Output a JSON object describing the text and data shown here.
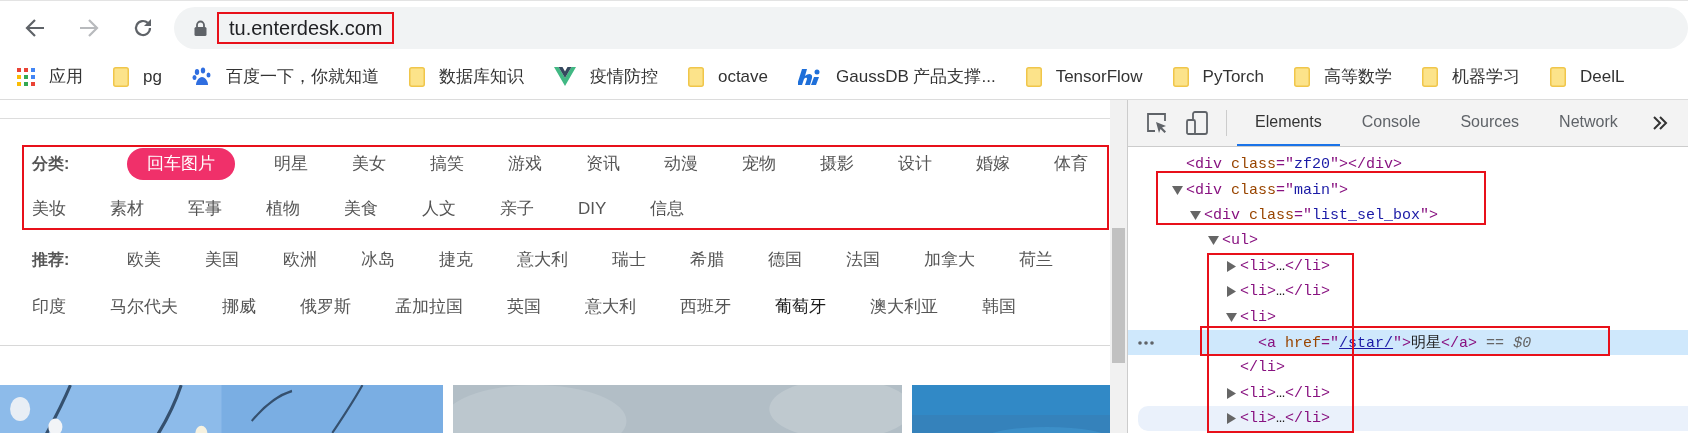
{
  "nav_buttons": [
    {
      "kind": "back",
      "disabled": false
    },
    {
      "kind": "forward",
      "disabled": true
    },
    {
      "kind": "reload",
      "disabled": false
    }
  ],
  "address_bar": {
    "url": "tu.enterdesk.com"
  },
  "bookmarks": [
    {
      "kind": "apps",
      "label": "应用"
    },
    {
      "kind": "folder",
      "label": "pg"
    },
    {
      "kind": "baidu",
      "label": "百度一下，你就知道"
    },
    {
      "kind": "folder",
      "label": "数据库知识"
    },
    {
      "kind": "vue",
      "label": "疫情防控"
    },
    {
      "kind": "folder",
      "label": "octave"
    },
    {
      "kind": "hi",
      "label": "GaussDB 产品支撑..."
    },
    {
      "kind": "folder",
      "label": "TensorFlow"
    },
    {
      "kind": "folder",
      "label": "PyTorch"
    },
    {
      "kind": "folder",
      "label": "高等数学"
    },
    {
      "kind": "folder",
      "label": "机器学习"
    },
    {
      "kind": "folder",
      "label": "DeelL"
    }
  ],
  "categories": {
    "label": "分类:",
    "items": [
      {
        "text": "回车图片",
        "selected": true
      },
      {
        "text": "明星",
        "selected": false
      },
      {
        "text": "美女",
        "selected": false
      },
      {
        "text": "搞笑",
        "selected": false
      },
      {
        "text": "游戏",
        "selected": false
      },
      {
        "text": "资讯",
        "selected": false
      },
      {
        "text": "动漫",
        "selected": false
      },
      {
        "text": "宠物",
        "selected": false
      },
      {
        "text": "摄影",
        "selected": false
      },
      {
        "text": "设计",
        "selected": false
      },
      {
        "text": "婚嫁",
        "selected": false
      },
      {
        "text": "体育",
        "selected": false
      },
      {
        "text": "美妆",
        "selected": false
      },
      {
        "text": "素材",
        "selected": false
      },
      {
        "text": "军事",
        "selected": false
      },
      {
        "text": "植物",
        "selected": false
      },
      {
        "text": "美食",
        "selected": false
      },
      {
        "text": "人文",
        "selected": false
      },
      {
        "text": "亲子",
        "selected": false
      },
      {
        "text": "DIY",
        "selected": false
      },
      {
        "text": "信息",
        "selected": false
      }
    ]
  },
  "recommend": {
    "label": "推荐:",
    "items": [
      {
        "text": "欧美",
        "hovered": false
      },
      {
        "text": "美国",
        "hovered": false
      },
      {
        "text": "欧洲",
        "hovered": false
      },
      {
        "text": "冰岛",
        "hovered": false
      },
      {
        "text": "捷克",
        "hovered": false
      },
      {
        "text": "意大利",
        "hovered": false
      },
      {
        "text": "瑞士",
        "hovered": false
      },
      {
        "text": "希腊",
        "hovered": false
      },
      {
        "text": "德国",
        "hovered": false
      },
      {
        "text": "法国",
        "hovered": false
      },
      {
        "text": "加拿大",
        "hovered": false
      },
      {
        "text": "荷兰",
        "hovered": false
      },
      {
        "text": "印度",
        "hovered": false
      },
      {
        "text": "马尔代夫",
        "hovered": false
      },
      {
        "text": "挪威",
        "hovered": false
      },
      {
        "text": "俄罗斯",
        "hovered": false
      },
      {
        "text": "孟加拉国",
        "hovered": false
      },
      {
        "text": "英国",
        "hovered": false
      },
      {
        "text": "意大利",
        "hovered": false
      },
      {
        "text": "西班牙",
        "hovered": false
      },
      {
        "text": "葡萄牙",
        "hovered": true
      },
      {
        "text": "澳大利亚",
        "hovered": false
      },
      {
        "text": "韩国",
        "hovered": false
      }
    ]
  },
  "devtools": {
    "tabs": [
      {
        "label": "Elements",
        "selected": true
      },
      {
        "label": "Console",
        "selected": false
      },
      {
        "label": "Sources",
        "selected": false
      },
      {
        "label": "Network",
        "selected": false
      }
    ],
    "dom_tree": [
      {
        "kind": "leaf",
        "selected": false,
        "hovered": false,
        "tokens": [
          {
            "kind": "tag",
            "t": "<div"
          },
          {
            "kind": "attr",
            "t": " class"
          },
          {
            "kind": "punct",
            "t": "=\""
          },
          {
            "kind": "value",
            "t": "zf20"
          },
          {
            "kind": "punct",
            "t": "\""
          },
          {
            "kind": "tag",
            "t": "></div>"
          }
        ]
      },
      {
        "kind": "element",
        "expanded": true,
        "selected": false,
        "hovered": false,
        "tokens": [
          {
            "kind": "tag",
            "t": "<div"
          },
          {
            "kind": "attr",
            "t": " class"
          },
          {
            "kind": "punct",
            "t": "=\""
          },
          {
            "kind": "value",
            "t": "main"
          },
          {
            "kind": "punct",
            "t": "\""
          },
          {
            "kind": "tag",
            "t": ">"
          }
        ],
        "children": [
          {
            "kind": "element",
            "expanded": true,
            "selected": false,
            "hovered": false,
            "tokens": [
              {
                "kind": "tag",
                "t": "<div"
              },
              {
                "kind": "attr",
                "t": " class"
              },
              {
                "kind": "punct",
                "t": "=\""
              },
              {
                "kind": "value",
                "t": "list_sel_box"
              },
              {
                "kind": "punct",
                "t": "\""
              },
              {
                "kind": "tag",
                "t": ">"
              }
            ],
            "children": [
              {
                "kind": "element",
                "expanded": true,
                "selected": false,
                "hovered": false,
                "tokens": [
                  {
                    "kind": "tag",
                    "t": "<ul>"
                  }
                ],
                "children": [
                  {
                    "kind": "element",
                    "expanded": false,
                    "selected": false,
                    "hovered": false,
                    "tokens": [
                      {
                        "kind": "tag",
                        "t": "<li>"
                      },
                      {
                        "kind": "text",
                        "t": "…"
                      },
                      {
                        "kind": "tag",
                        "t": "</li>"
                      }
                    ]
                  },
                  {
                    "kind": "element",
                    "expanded": false,
                    "selected": false,
                    "hovered": false,
                    "tokens": [
                      {
                        "kind": "tag",
                        "t": "<li>"
                      },
                      {
                        "kind": "text",
                        "t": "…"
                      },
                      {
                        "kind": "tag",
                        "t": "</li>"
                      }
                    ]
                  },
                  {
                    "kind": "element",
                    "expanded": true,
                    "selected": false,
                    "hovered": false,
                    "tokens": [
                      {
                        "kind": "tag",
                        "t": "<li>"
                      }
                    ],
                    "close_tokens": [
                      {
                        "kind": "tag",
                        "t": "</li>"
                      }
                    ],
                    "children": [
                      {
                        "kind": "leaf",
                        "selected": true,
                        "hovered": false,
                        "tokens": [
                          {
                            "kind": "tag",
                            "t": "<a"
                          },
                          {
                            "kind": "attr",
                            "t": " href"
                          },
                          {
                            "kind": "punct",
                            "t": "=\""
                          },
                          {
                            "kind": "link",
                            "t": "/star/"
                          },
                          {
                            "kind": "punct",
                            "t": "\""
                          },
                          {
                            "kind": "tag",
                            "t": ">"
                          },
                          {
                            "kind": "text",
                            "t": "明星"
                          },
                          {
                            "kind": "tag",
                            "t": "</a>"
                          },
                          {
                            "kind": "console",
                            "t": " == "
                          },
                          {
                            "kind": "var",
                            "t": "$0"
                          }
                        ]
                      }
                    ]
                  },
                  {
                    "kind": "element",
                    "expanded": false,
                    "selected": false,
                    "hovered": false,
                    "tokens": [
                      {
                        "kind": "tag",
                        "t": "<li>"
                      },
                      {
                        "kind": "text",
                        "t": "…"
                      },
                      {
                        "kind": "tag",
                        "t": "</li>"
                      }
                    ]
                  },
                  {
                    "kind": "element",
                    "expanded": false,
                    "selected": false,
                    "hovered": true,
                    "tokens": [
                      {
                        "kind": "tag",
                        "t": "<li>"
                      },
                      {
                        "kind": "text",
                        "t": "…"
                      },
                      {
                        "kind": "tag",
                        "t": "</li>"
                      }
                    ]
                  }
                ]
              }
            ]
          }
        ]
      }
    ]
  }
}
